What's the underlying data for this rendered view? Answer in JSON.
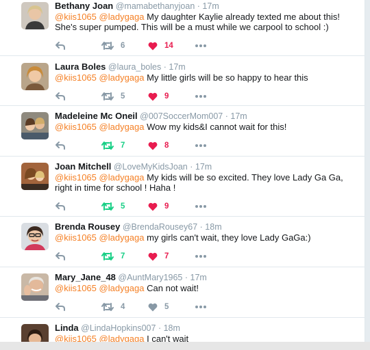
{
  "tweets": [
    {
      "name": "Bethany Joan",
      "handle": "@mamabethanyjoan",
      "sep": "·",
      "time": "17m",
      "m1": "@kiis1065",
      "m2": "@ladygaga",
      "text": "My daughter Kaylie already texted me about this! She's super pumped. This will be a must while we carpool to school :)",
      "retweets": "6",
      "likes": "14",
      "retweeted": false,
      "liked": true
    },
    {
      "name": "Laura Boles",
      "handle": "@laura_boles",
      "sep": "·",
      "time": "17m",
      "m1": "@kiis1065",
      "m2": "@ladygaga",
      "text": "My little girls will be so happy to hear this",
      "retweets": "5",
      "likes": "9",
      "retweeted": false,
      "liked": true
    },
    {
      "name": "Madeleine Mc Oneil",
      "handle": "@007SoccerMom007",
      "sep": "·",
      "time": "17m",
      "m1": "@kiis1065",
      "m2": "@ladygaga",
      "text": "Wow my kids&I cannot wait for this!",
      "retweets": "7",
      "likes": "8",
      "retweeted": true,
      "liked": true
    },
    {
      "name": "Joan Mitchell",
      "handle": "@LoveMyKidsJoan",
      "sep": "·",
      "time": "17m",
      "m1": "@kiis1065",
      "m2": "@ladygaga",
      "text": "My kids will be so excited. They love Lady Ga Ga, right in time for school ! Haha !",
      "retweets": "5",
      "likes": "9",
      "retweeted": true,
      "liked": true
    },
    {
      "name": "Brenda Rousey",
      "handle": "@BrendaRousey67",
      "sep": "·",
      "time": "18m",
      "m1": "@kiis1065",
      "m2": "@ladygaga",
      "text": "my girls can't wait, they love Lady GaGa:)",
      "retweets": "7",
      "likes": "7",
      "retweeted": true,
      "liked": true
    },
    {
      "name": "Mary_Jane_48",
      "handle": "@AuntMary1965",
      "sep": "·",
      "time": "17m",
      "m1": "@kiis1065",
      "m2": "@ladygaga",
      "text": "Can not wait!",
      "retweets": "4",
      "likes": "5",
      "retweeted": false,
      "liked": false
    },
    {
      "name": "Linda",
      "handle": "@LindaHopkins007",
      "sep": "·",
      "time": "18m",
      "m1": "@kiis1065",
      "m2": "@ladygaga",
      "text": "I can't wait",
      "retweets": "",
      "likes": "",
      "retweeted": false,
      "liked": false
    }
  ],
  "colors": {
    "mention": "#f58025",
    "retweet_active": "#19cf86",
    "like_active": "#e81c4f",
    "muted": "#8899a6"
  },
  "icons": [
    "reply-icon",
    "retweet-icon",
    "heart-icon",
    "more-icon"
  ]
}
